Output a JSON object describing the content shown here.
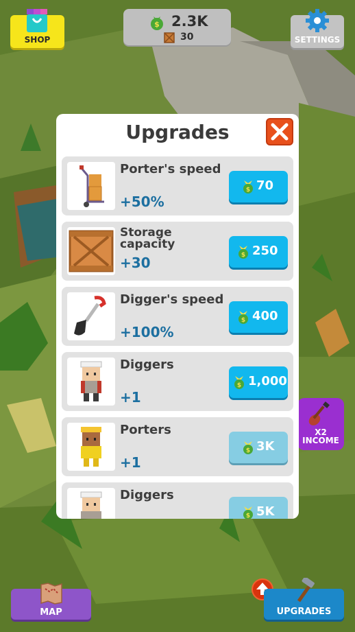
{
  "hud": {
    "shop_label": "SHOP",
    "money": "2.3K",
    "crates": "30",
    "settings_label": "SETTINGS",
    "x2_label_line1": "X2",
    "x2_label_line2": "INCOME",
    "map_label": "MAP",
    "upgrades_label": "UPGRADES"
  },
  "modal": {
    "title": "Upgrades",
    "items": [
      {
        "name": "Porter's speed",
        "bonus": "+50%",
        "price": "70",
        "locked": false,
        "icon": "hand-truck-icon"
      },
      {
        "name": "Storage capacity",
        "bonus": "+30",
        "price": "250",
        "locked": false,
        "icon": "crate-icon"
      },
      {
        "name": "Digger's speed",
        "bonus": "+100%",
        "price": "400",
        "locked": false,
        "icon": "shovel-icon"
      },
      {
        "name": "Diggers",
        "bonus": "+1",
        "price": "1,000",
        "locked": false,
        "icon": "digger-worker-icon"
      },
      {
        "name": "Porters",
        "bonus": "+1",
        "price": "3K",
        "locked": true,
        "icon": "porter-worker-icon"
      },
      {
        "name": "Diggers",
        "bonus": "",
        "price": "5K",
        "locked": true,
        "icon": "digger-worker-icon"
      }
    ]
  },
  "colors": {
    "buy_active": "#12b8ee",
    "buy_locked": "#86cde3",
    "close": "#e8501c",
    "bonus_text": "#1c6fa0"
  }
}
